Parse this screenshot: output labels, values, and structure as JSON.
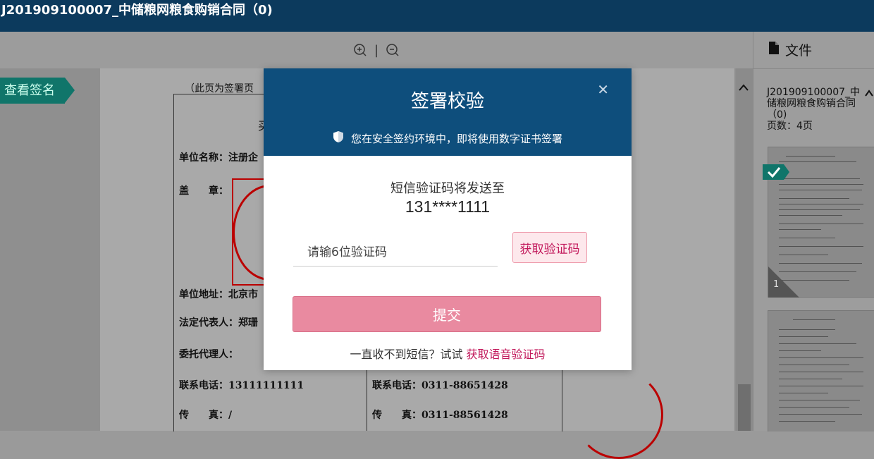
{
  "topbar": {
    "title": "J201909100007_中储粮网粮食购销合同（0)"
  },
  "viewer": {
    "zoom_in_icon": "zoom-in-icon",
    "zoom_separator": "|",
    "zoom_out_icon": "zoom-out-icon",
    "signature_tag": "查看签名",
    "document": {
      "page_note": "（此页为签署页",
      "fields_left": [
        {
          "label": "单位名称：注册企"
        },
        {
          "label": "盖　　章："
        },
        {
          "label": "单位地址：北京市"
        },
        {
          "label": "法定代表人：郑珊"
        },
        {
          "label": "委托代理人："
        },
        {
          "label": "联系电话：13111111111"
        },
        {
          "label": "传　　真：/"
        }
      ],
      "fields_right": [
        {
          "label": "联系电话：0311-88651428"
        },
        {
          "label": "传　　真：0311-88561428"
        }
      ],
      "partial_heading_char": "买"
    }
  },
  "file_panel": {
    "header": "文件",
    "file_name": "J201909100007_中储粮网粮食购销合同（0)",
    "page_count": "页数：4页",
    "page_number": "1"
  },
  "modal": {
    "title": "签署校验",
    "close_icon": "close-icon",
    "secure_notice": "您在安全签约环境中，即将使用数字证书签署",
    "sms_label": "短信验证码将发送至",
    "phone_masked": "131****1111",
    "code_input": {
      "placeholder": "请输6位验证码",
      "value": ""
    },
    "get_code_button": "获取验证码",
    "submit_button": "提交",
    "voice_hint_prefix": "一直收不到短信？试试",
    "voice_link": "获取语音验证码"
  },
  "colors": {
    "topbar": "#0c3a5d",
    "modal_header": "#0e4e7c",
    "accent_pink": "#c2185b",
    "submit_bg": "#e98aa0",
    "signature_tag": "#10756a"
  }
}
